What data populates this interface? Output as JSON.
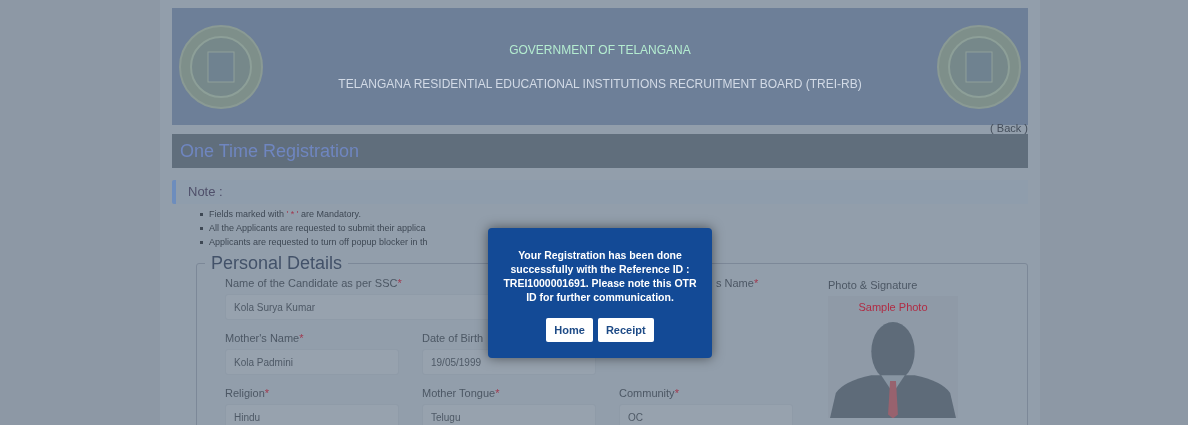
{
  "header": {
    "title": "GOVERNMENT OF TELANGANA",
    "subtitle": "TELANGANA RESIDENTIAL EDUCATIONAL INSTITUTIONS RECRUITMENT BOARD (TREI-RB)"
  },
  "back_link": "( Back )",
  "page_title": "One Time Registration",
  "note": {
    "heading": "Note :",
    "items": [
      {
        "text": "Fields marked with",
        "highlight": "' * '",
        "rest": "are Mandatory."
      },
      {
        "text": "All the Applicants are requested to submit their applica"
      },
      {
        "text": "Applicants are requested to turn off popup blocker in th"
      }
    ]
  },
  "section": {
    "title": "Personal Details",
    "rows": [
      [
        {
          "kind": "wide",
          "label": "Name of the Candidate as per SSC",
          "mark": "*",
          "value": "Kola Surya Kumar"
        },
        {
          "kind": "partial",
          "label": "s Name",
          "mark": "*"
        }
      ],
      [
        {
          "kind": "normal",
          "label": "Mother's Name",
          "mark": "*",
          "value": "Kola Padmini"
        },
        {
          "kind": "normal",
          "label": "Date of Birth",
          "value": "19/05/1999"
        },
        {
          "kind": "hidden"
        }
      ],
      [
        {
          "kind": "normal",
          "label": "Religion",
          "mark": "*",
          "value": "Hindu"
        },
        {
          "kind": "normal",
          "label": "Mother Tongue",
          "mark": "*",
          "value": "Telugu"
        },
        {
          "kind": "normal",
          "label": "Community",
          "mark": "*",
          "value": "OC"
        }
      ]
    ],
    "photo": {
      "label": "Photo & Signature",
      "caption": "Sample Photo"
    }
  },
  "dialog": {
    "message": "Your Registration has been done successfully with the Reference ID : TREI1000001691. Please note this OTR ID for further communication.",
    "buttons": [
      "Home",
      "Receipt"
    ]
  }
}
